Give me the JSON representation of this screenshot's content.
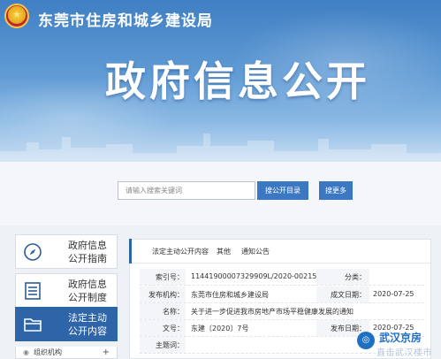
{
  "header": {
    "site_title": "东莞市住房和城乡建设局",
    "banner_title": "政府信息公开",
    "emblem_icon": "national-emblem-icon",
    "colors": {
      "banner_top": "#3f7fc3",
      "banner_bottom": "#c9def2"
    }
  },
  "search": {
    "placeholder": "请输入搜索关键词",
    "directory_button": "搜公开目录",
    "more_button": "搜更多",
    "button_color": "#3c78c2"
  },
  "sidebar": {
    "items": [
      {
        "line1": "政府信息",
        "line2": "公开指南",
        "icon": "compass-icon",
        "active": false
      },
      {
        "line1": "政府信息",
        "line2": "公开制度",
        "icon": "document-list-icon",
        "active": false
      },
      {
        "line1": "法定主动",
        "line2": "公开内容",
        "icon": "folder-icon",
        "active": true
      }
    ],
    "sub_item": {
      "label": "组织机构",
      "expand": "+"
    },
    "active_color": "#2e64a8"
  },
  "main": {
    "breadcrumb": [
      "法定主动公开内容",
      "其他",
      "通知公告"
    ],
    "rows": {
      "index_label": "索引号：",
      "index_value": "11441900007329909L/2020-00215",
      "category_label": "分类：",
      "category_value": "",
      "org_label": "发布机构：",
      "org_value": "东莞市住房和城乡建设局",
      "date_label": "成文日期：",
      "date_value": "2020-07-25",
      "name_label": "名称：",
      "name_value": "关于进一步促进我市房地产市场平稳健康发展的通知",
      "doc_label": "文号：",
      "doc_value": "东建〔2020〕7号",
      "pub_label": "发布日期：",
      "pub_value": "2020-07-25",
      "theme_label": "主题词："
    }
  },
  "watermark": {
    "title": "武汉京房",
    "subtitle": "直击武汉楼市"
  }
}
